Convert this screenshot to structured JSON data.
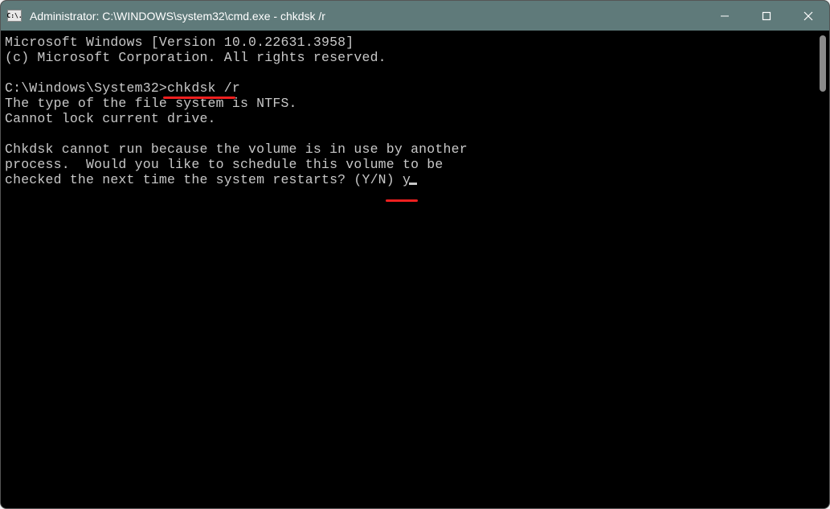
{
  "titlebar": {
    "icon_text": "C:\\.",
    "title": "Administrator: C:\\WINDOWS\\system32\\cmd.exe - chkdsk  /r"
  },
  "terminal": {
    "line1": "Microsoft Windows [Version 10.0.22631.3958]",
    "line2": "(c) Microsoft Corporation. All rights reserved.",
    "blank1": "",
    "prompt": "C:\\Windows\\System32>",
    "command": "chkdsk /r",
    "line4": "The type of the file system is NTFS.",
    "line5": "Cannot lock current drive.",
    "blank2": "",
    "line6": "Chkdsk cannot run because the volume is in use by another",
    "line7": "process.  Would you like to schedule this volume to be",
    "line8a": "checked the next time the system restarts? (Y/N) ",
    "input": "y"
  }
}
